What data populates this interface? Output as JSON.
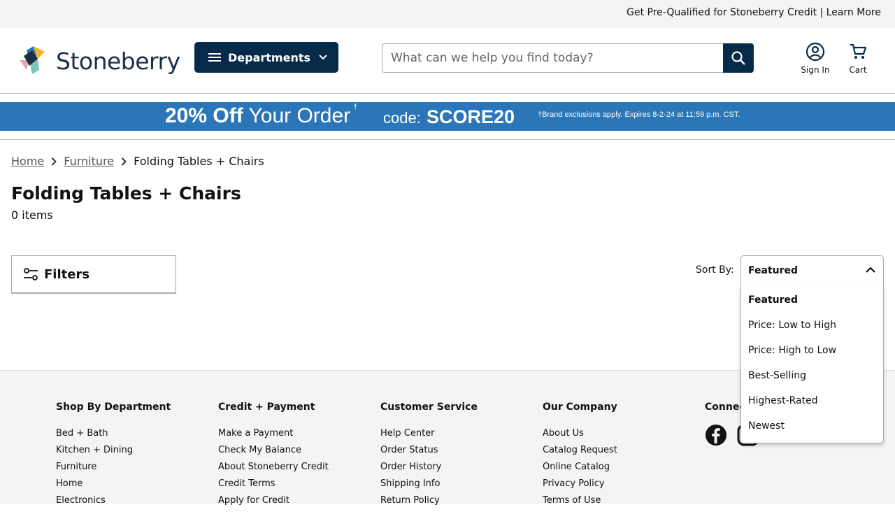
{
  "topbar": {
    "promo_text": "Get Pre-Qualified for Stoneberry Credit | Learn More"
  },
  "header": {
    "logo_text": "Stoneberry",
    "departments_label": "Departments",
    "search_placeholder": "What can we help you find today?",
    "sign_in_label": "Sign In",
    "cart_label": "Cart"
  },
  "banner": {
    "percent": "20% Off",
    "your_order": "Your Order",
    "dagger": "†",
    "code_label": "code:",
    "code": "SCORE20",
    "fine_print": "†Brand exclusions apply. Expires 8-2-24 at 11:59 p.m. CST."
  },
  "breadcrumb": {
    "items": [
      {
        "label": "Home"
      },
      {
        "label": "Furniture"
      }
    ],
    "current": "Folding Tables + Chairs"
  },
  "page": {
    "title": "Folding Tables + Chairs",
    "count": "0 items"
  },
  "filters": {
    "label": "Filters"
  },
  "sort": {
    "label": "Sort By:",
    "selected": "Featured",
    "options": [
      "Featured",
      "Price: Low to High",
      "Price: High to Low",
      "Best-Selling",
      "Highest-Rated",
      "Newest"
    ]
  },
  "footer": {
    "columns": [
      {
        "heading": "Shop By Department",
        "links": [
          "Bed + Bath",
          "Kitchen + Dining",
          "Furniture",
          "Home",
          "Electronics"
        ]
      },
      {
        "heading": "Credit + Payment",
        "links": [
          "Make a Payment",
          "Check My Balance",
          "About Stoneberry Credit",
          "Credit Terms",
          "Apply for Credit"
        ]
      },
      {
        "heading": "Customer Service",
        "links": [
          "Help Center",
          "Order Status",
          "Order History",
          "Shipping Info",
          "Return Policy"
        ]
      },
      {
        "heading": "Our Company",
        "links": [
          "About Us",
          "Catalog Request",
          "Online Catalog",
          "Privacy Policy",
          "Terms of Use"
        ]
      },
      {
        "heading": "Connect"
      }
    ]
  },
  "colors": {
    "navy": "#062b4a",
    "banner_blue": "#2a76b8"
  }
}
